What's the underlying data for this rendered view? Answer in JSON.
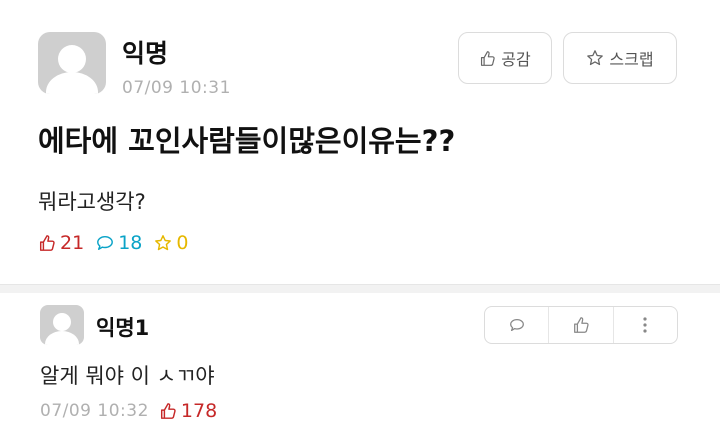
{
  "post": {
    "author": "익명",
    "time": "07/09 10:31",
    "buttons": {
      "like_label": "공감",
      "scrap_label": "스크랩"
    },
    "title": "에타에 꼬인사람들이많은이유는??",
    "body": "뭐라고생각?",
    "stats": {
      "likes": "21",
      "comments": "18",
      "scraps": "0"
    }
  },
  "comment": {
    "author": "익명1",
    "text": "알게 뭐야 이 ㅅㄲ야",
    "time": "07/09 10:32",
    "likes": "178"
  },
  "icons": {
    "like": "thumbs-up-icon",
    "scrap": "star-icon",
    "comment": "speech-bubble-icon",
    "more": "more-vertical-icon"
  },
  "colors": {
    "like": "#c62828",
    "comment": "#0aa3c7",
    "scrap": "#e6b800",
    "muted": "#b0b0b0"
  }
}
